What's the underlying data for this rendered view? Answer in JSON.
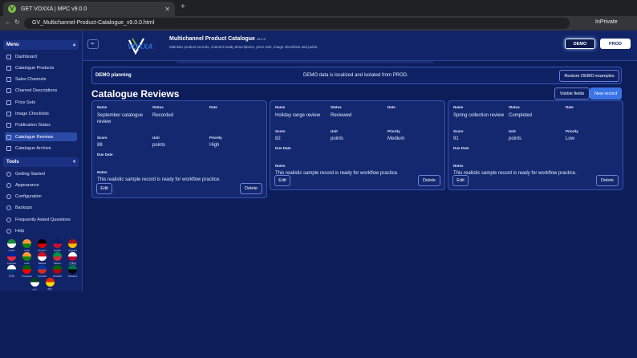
{
  "browser": {
    "tab_title": "GET VOXXA | MPC v9.0.0",
    "favicon_letter": "V",
    "new_tab": "+",
    "url": "GV_Multichannel-Product-Catalogue_v9.0.0.html",
    "mode": "InPrivate"
  },
  "header": {
    "logo_text": "VOXXA",
    "title": "Multichannel Product Catalogue",
    "version": "v9.0.0",
    "subtitle": "Maintain product records, channel-ready descriptions, price sets, image checklists and public",
    "demo_label": "DEMO",
    "prod_label": "PROD"
  },
  "sidebar": {
    "menu_label": "Menu",
    "tools_label": "Tools",
    "menu_items": [
      {
        "label": "Dashboard",
        "icon": "dashboard-icon"
      },
      {
        "label": "Catalogue Products",
        "icon": "products-icon"
      },
      {
        "label": "Sales Channels",
        "icon": "channels-icon"
      },
      {
        "label": "Channel Descriptions",
        "icon": "descriptions-icon"
      },
      {
        "label": "Price Sets",
        "icon": "price-icon"
      },
      {
        "label": "Image Checklists",
        "icon": "image-icon"
      },
      {
        "label": "Publication Status",
        "icon": "status-icon"
      },
      {
        "label": "Catalogue Reviews",
        "icon": "reviews-icon"
      },
      {
        "label": "Catalogue Archive",
        "icon": "archive-icon"
      }
    ],
    "tool_items": [
      {
        "label": "Getting Started",
        "icon": "rocket-icon"
      },
      {
        "label": "Appearance",
        "icon": "palette-icon"
      },
      {
        "label": "Configuration",
        "icon": "gear-icon"
      },
      {
        "label": "Backups",
        "icon": "backup-icon"
      },
      {
        "label": "Frequently Asked Questions",
        "icon": "faq-icon"
      },
      {
        "label": "Help",
        "icon": "help-icon"
      }
    ],
    "active": "Catalogue Reviews",
    "languages": [
      {
        "label": "Arabic",
        "colors": [
          "#1a8a3a",
          "#ffffff"
        ]
      },
      {
        "label": "Hindi",
        "colors": [
          "#ff9933",
          "#138808"
        ]
      },
      {
        "label": "Deutsch",
        "colors": [
          "#000000",
          "#dd0000"
        ]
      },
      {
        "label": "English",
        "colors": [
          "#012169",
          "#c8102e"
        ]
      },
      {
        "label": "Español",
        "colors": [
          "#aa151b",
          "#f1bf00"
        ]
      },
      {
        "label": "Français",
        "colors": [
          "#002395",
          "#ed2939"
        ]
      },
      {
        "label": "Hindi",
        "colors": [
          "#ff9933",
          "#138808"
        ]
      },
      {
        "label": "Bahasa",
        "colors": [
          "#ce1126",
          "#ffffff"
        ]
      },
      {
        "label": "Italiano",
        "colors": [
          "#009246",
          "#ce2b37"
        ]
      },
      {
        "label": "日本語",
        "colors": [
          "#ffffff",
          "#bc002d"
        ]
      },
      {
        "label": "한국어",
        "colors": [
          "#ffffff",
          "#003478"
        ]
      },
      {
        "label": "Português",
        "colors": [
          "#006600",
          "#ff0000"
        ]
      },
      {
        "label": "Русский",
        "colors": [
          "#0039a6",
          "#d52b1e"
        ]
      },
      {
        "label": "Kiswahili",
        "colors": [
          "#006600",
          "#bb0000"
        ]
      },
      {
        "label": "Afrikaans",
        "colors": [
          "#007749",
          "#000000"
        ]
      },
      {
        "label": "اردو",
        "colors": [
          "#01411c",
          "#ffffff"
        ]
      },
      {
        "label": "中文",
        "colors": [
          "#de2910",
          "#ffde00"
        ]
      }
    ]
  },
  "main": {
    "banner": {
      "title": "DEMO planning",
      "text": "DEMO data is localized and isolated from PROD.",
      "restore_label": "Restore DEMO examples"
    },
    "page_title": "Catalogue Reviews",
    "visible_fields_label": "Visible fields",
    "new_record_label": "New record",
    "field_labels": {
      "name": "Name",
      "status": "Status",
      "date": "Date",
      "score": "Score",
      "unit": "Unit",
      "priority": "Priority",
      "due_date": "Due Date",
      "notes": "Notes"
    },
    "edit_label": "Edit",
    "delete_label": "Delete",
    "records": [
      {
        "name": "September catalogue review",
        "status": "Recorded",
        "date": "",
        "score": "88",
        "unit": "points",
        "priority": "High",
        "due_date": "",
        "notes": "This realistic sample record is ready for workflow practice."
      },
      {
        "name": "Holiday range review",
        "status": "Reviewed",
        "date": "",
        "score": "82",
        "unit": "points",
        "priority": "Medium",
        "due_date": "",
        "notes": "This realistic sample record is ready for workflow practice."
      },
      {
        "name": "Spring collection review",
        "status": "Completed",
        "date": "",
        "score": "91",
        "unit": "points",
        "priority": "Low",
        "due_date": "",
        "notes": "This realistic sample record is ready for workflow practice."
      }
    ]
  }
}
